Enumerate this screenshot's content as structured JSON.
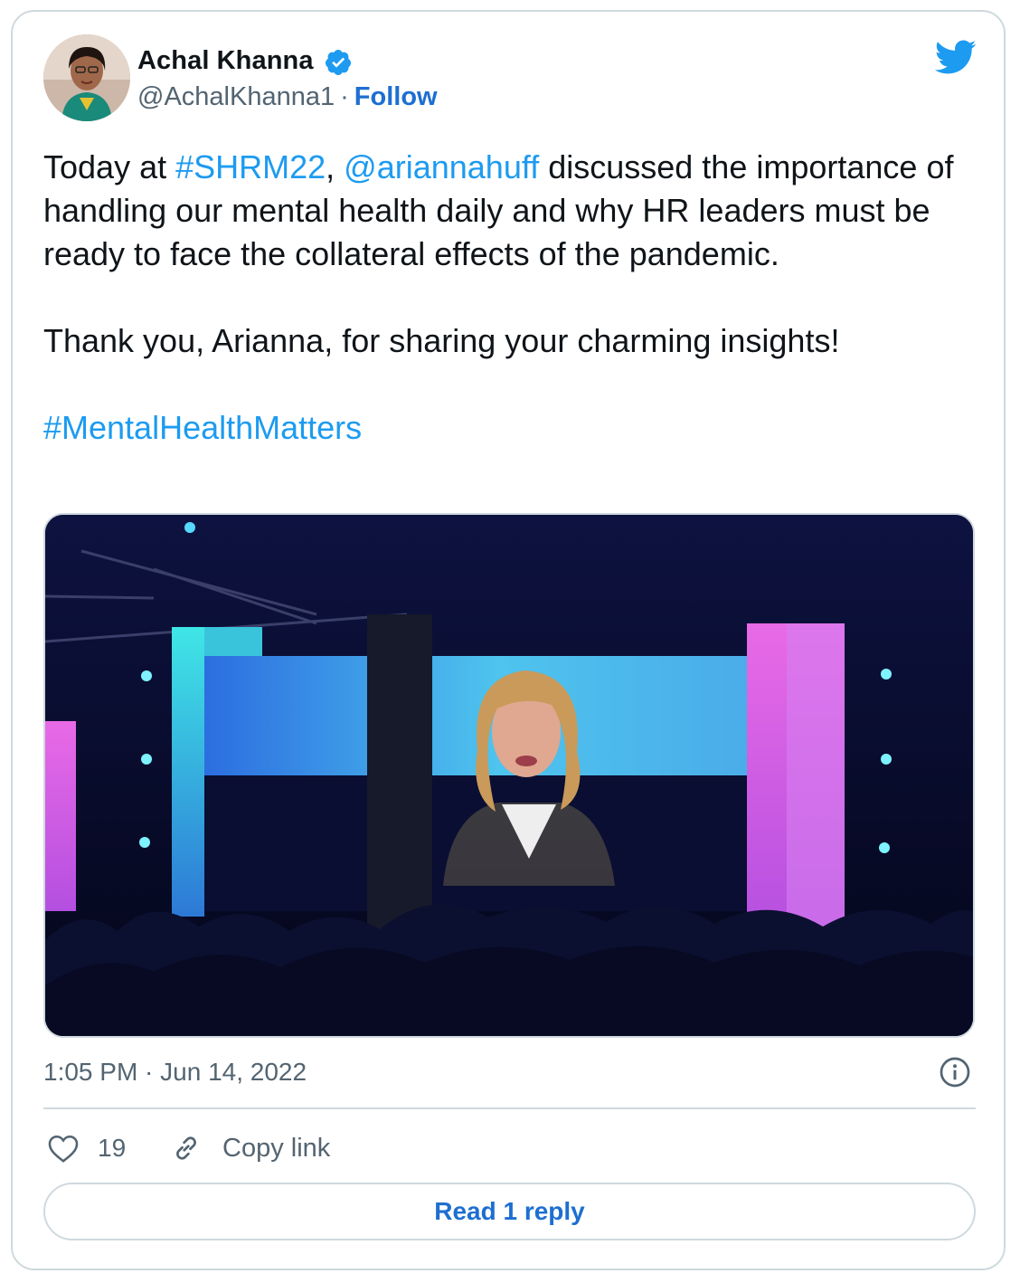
{
  "author": {
    "name": "Achal Khanna",
    "handle": "@AchalKhanna1",
    "separator": "·",
    "follow_label": "Follow"
  },
  "tweet": {
    "line1_prefix": "Today at ",
    "hashtag_event": "#SHRM22",
    "comma": ", ",
    "mention": "@ariannahuff",
    "line1_rest": " discussed the importance of handling our mental health daily and why HR leaders must be ready to face the collateral effects of the pandemic.",
    "paragraph2": "Thank you, Arianna, for sharing your charming insights!",
    "hashtag_topic": "#MentalHealthMatters"
  },
  "meta": {
    "timestamp": "1:05 PM · Jun 14, 2022"
  },
  "actions": {
    "like_count": "19",
    "copy_link_label": "Copy link",
    "read_reply_label": "Read 1 reply"
  },
  "icons": {
    "verified": "verified-badge-icon",
    "twitter": "twitter-bird-icon",
    "info": "info-icon",
    "like": "heart-icon",
    "link": "link-icon"
  },
  "colors": {
    "link_blue": "#1d9bf0",
    "follow_blue": "#1d6fd1",
    "text": "#0f1419",
    "muted": "#536471",
    "border": "#cfd9de"
  }
}
